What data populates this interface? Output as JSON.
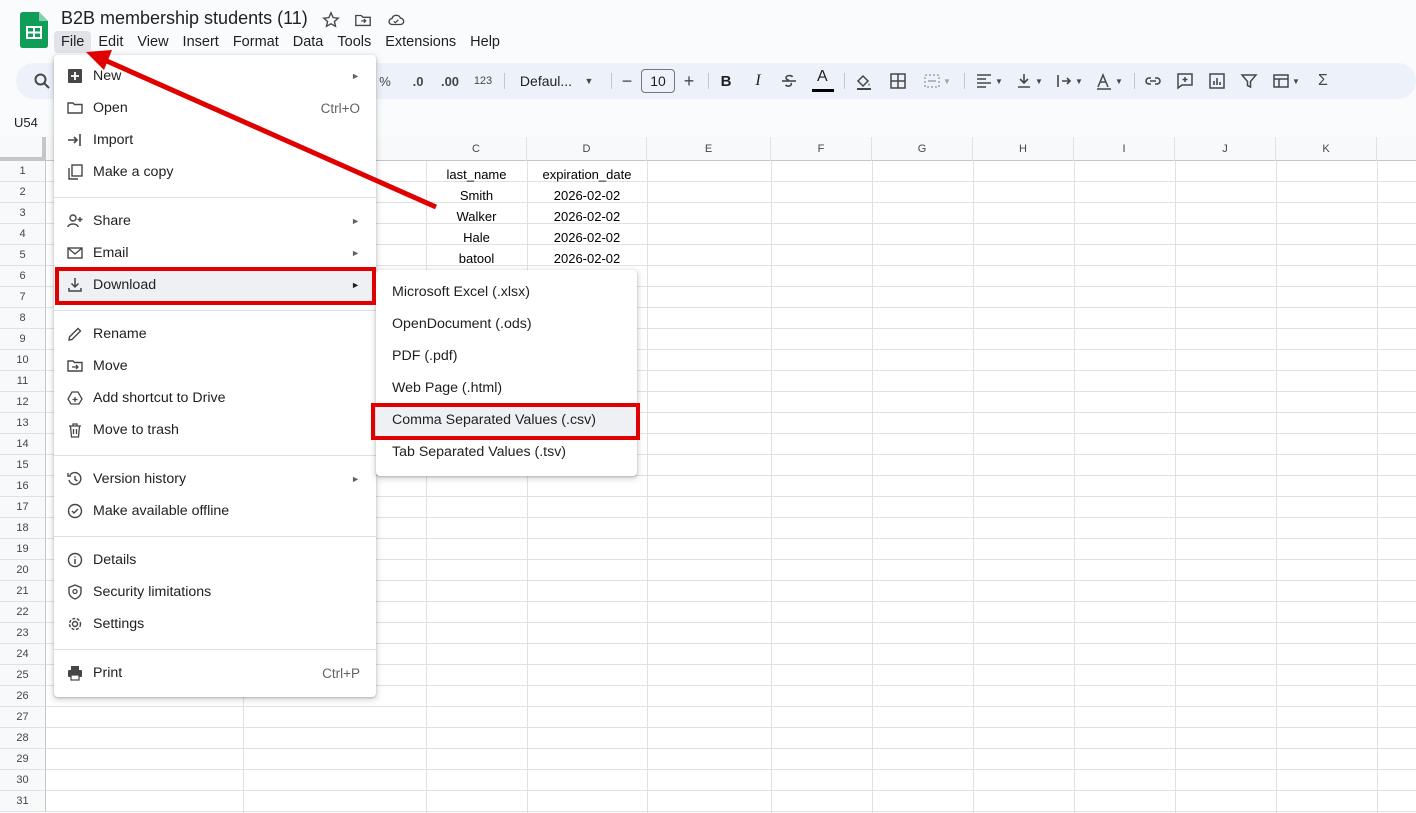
{
  "window": {
    "doc_title": "B2B membership students (11)",
    "icons": [
      "star-icon",
      "move-to-folder-icon",
      "cloud-saved-icon"
    ]
  },
  "menubar": [
    "File",
    "Edit",
    "View",
    "Insert",
    "Format",
    "Data",
    "Tools",
    "Extensions",
    "Help"
  ],
  "toolbar": {
    "percent": "%",
    "decrease_decimal": ".0",
    "increase_decimal": ".00",
    "number_format": "123",
    "font": "Defaul...",
    "font_size": "10",
    "minus": "−",
    "plus": "+",
    "bold": "B",
    "italic": "I",
    "text_color": "A",
    "sum": "Σ"
  },
  "name_box": "U54",
  "columns": [
    "C",
    "D",
    "E",
    "F",
    "G",
    "H",
    "I",
    "J",
    "K"
  ],
  "rows": [
    "1",
    "2",
    "3",
    "4",
    "5",
    "6",
    "7",
    "8",
    "9",
    "10",
    "11",
    "12",
    "13",
    "14",
    "15",
    "16",
    "17",
    "18",
    "19",
    "20",
    "21",
    "22",
    "23",
    "24",
    "25",
    "26",
    "27",
    "28",
    "29",
    "30",
    "31"
  ],
  "sheet": {
    "headers": [
      "last_name",
      "expiration_date"
    ],
    "rows": [
      [
        "Smith",
        "2026-02-02"
      ],
      [
        "Walker",
        "2026-02-02"
      ],
      [
        "Hale",
        "2026-02-02"
      ],
      [
        "batool",
        "2026-02-02"
      ]
    ]
  },
  "file_menu": {
    "new": "New",
    "open": "Open",
    "open_shortcut": "Ctrl+O",
    "import": "Import",
    "make_copy": "Make a copy",
    "share": "Share",
    "email": "Email",
    "download": "Download",
    "rename": "Rename",
    "move": "Move",
    "add_shortcut": "Add shortcut to Drive",
    "trash": "Move to trash",
    "version_history": "Version history",
    "offline": "Make available offline",
    "details": "Details",
    "security": "Security limitations",
    "settings": "Settings",
    "print": "Print",
    "print_shortcut": "Ctrl+P",
    "submenu_arrow": "►"
  },
  "download_menu": {
    "xlsx": "Microsoft Excel (.xlsx)",
    "ods": "OpenDocument (.ods)",
    "pdf": "PDF (.pdf)",
    "html": "Web Page (.html)",
    "csv": "Comma Separated Values (.csv)",
    "tsv": "Tab Separated Values (.tsv)"
  },
  "colors": {
    "annotation_red": "#e00000",
    "sheets_green": "#0f9d58",
    "toolbar_bg": "#edf2fa"
  }
}
